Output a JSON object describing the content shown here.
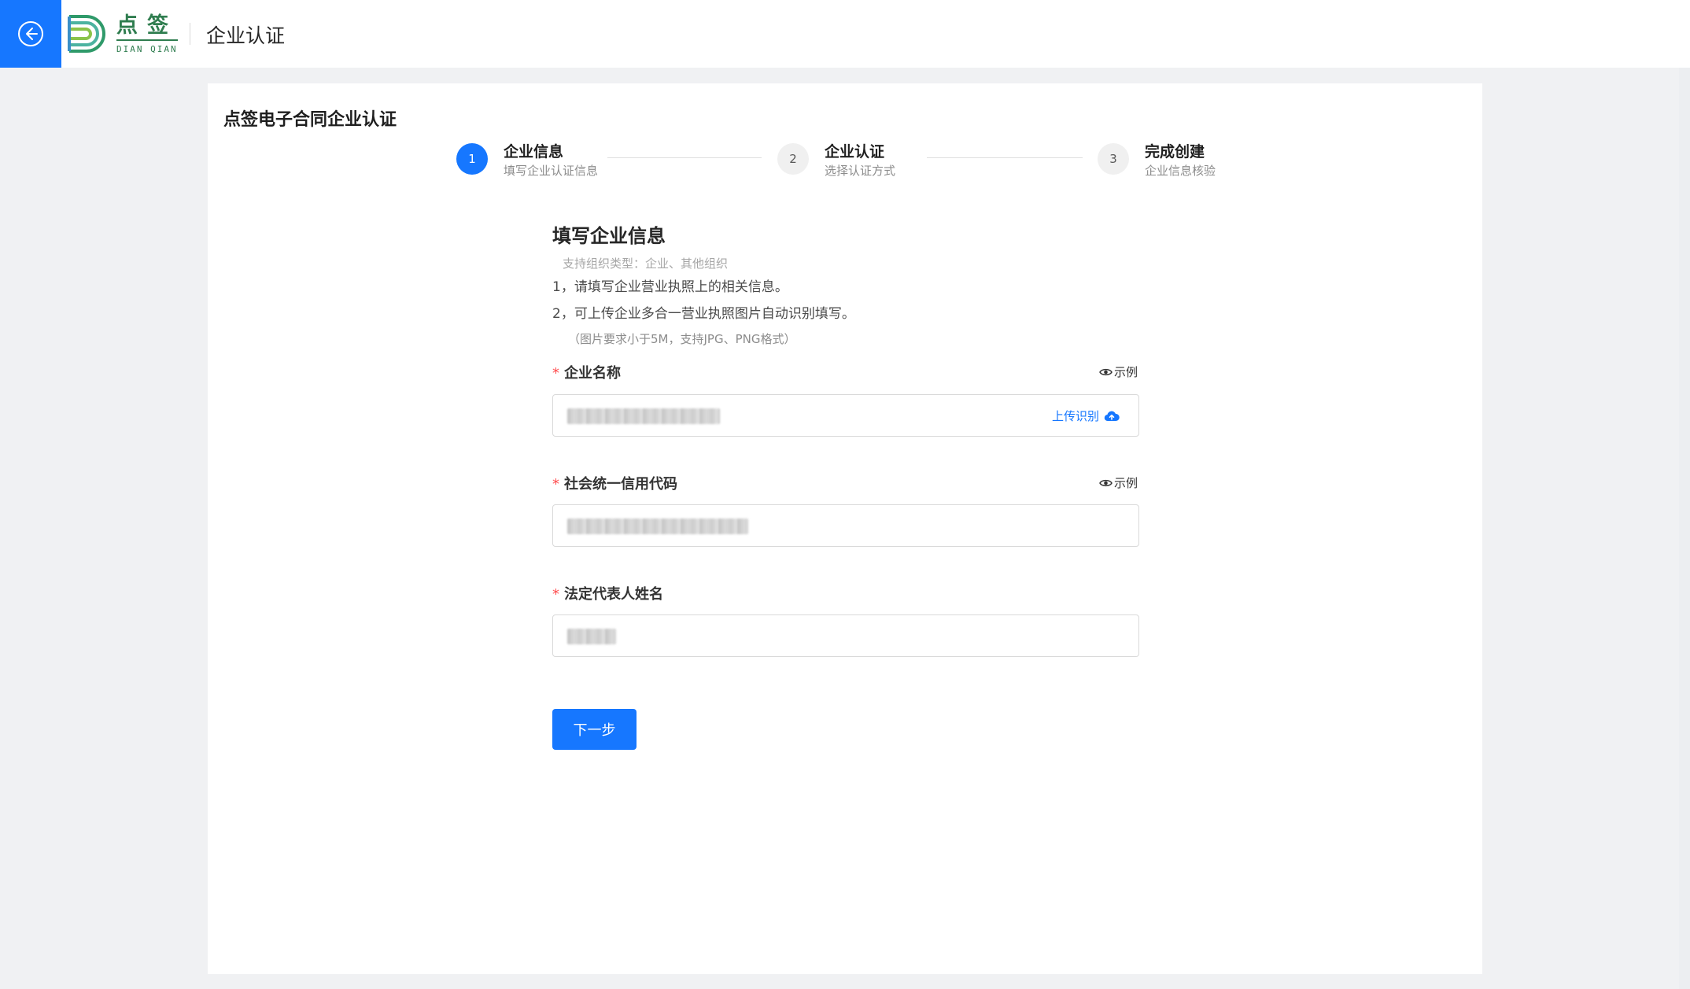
{
  "header": {
    "logo_cn": "点签",
    "logo_en": "DIAN QIAN",
    "title": "企业认证",
    "back_icon": "arrow-left-circle-icon"
  },
  "card": {
    "title": "点签电子合同企业认证"
  },
  "steps": [
    {
      "number": "1",
      "title": "企业信息",
      "desc": "填写企业认证信息",
      "active": true
    },
    {
      "number": "2",
      "title": "企业认证",
      "desc": "选择认证方式",
      "active": false
    },
    {
      "number": "3",
      "title": "完成创建",
      "desc": "企业信息核验",
      "active": false
    }
  ],
  "form": {
    "heading": "填写企业信息",
    "support_types": "支持组织类型：企业、其他组织",
    "notes": [
      "1，请填写企业营业执照上的相关信息。",
      "2，可上传企业多合一营业执照图片自动识别填写。"
    ],
    "image_requirement": "（图片要求小于5M，支持JPG、PNG格式）",
    "fields": {
      "company_name": {
        "label": "企业名称",
        "required": "*",
        "example": "示例",
        "upload": "上传识别"
      },
      "credit_code": {
        "label": "社会统一信用代码",
        "required": "*",
        "example": "示例"
      },
      "legal_rep": {
        "label": "法定代表人姓名",
        "required": "*"
      }
    },
    "next_button": "下一步"
  },
  "colors": {
    "primary": "#1677ff",
    "brand_green": "#2f7d4f",
    "required": "#ff4d4f"
  }
}
